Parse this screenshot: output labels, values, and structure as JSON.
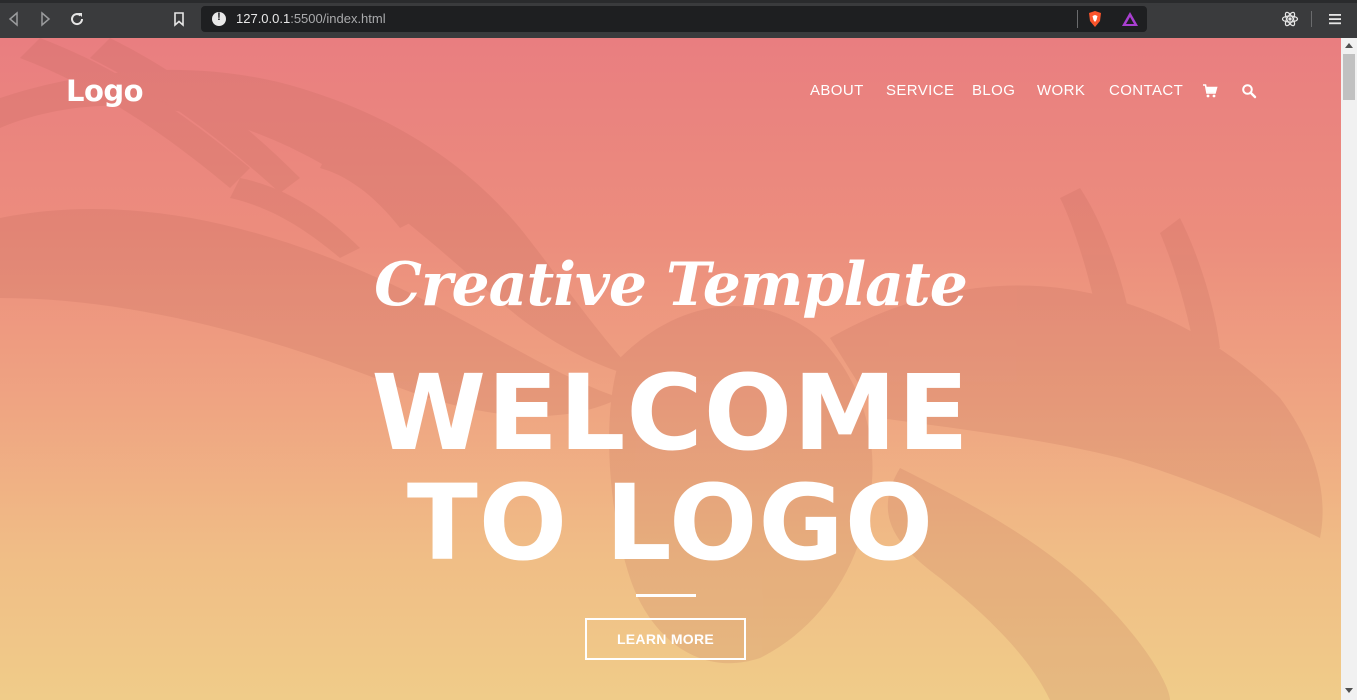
{
  "browser": {
    "url_host": "127.0.0.1",
    "url_rest": ":5500/index.html",
    "icons": [
      "back-icon",
      "forward-icon",
      "reload-icon",
      "bookmark-icon",
      "info-icon",
      "brave-shields-icon",
      "brave-rewards-icon",
      "react-devtools-icon",
      "menu-icon"
    ]
  },
  "site": {
    "logo": "Logo",
    "nav": [
      "ABOUT",
      "SERVICE",
      "BLOG",
      "WORK",
      "CONTACT"
    ],
    "nav_icons": [
      "cart-icon",
      "search-icon"
    ]
  },
  "hero": {
    "script_title": "Creative Template",
    "line1": "WELCOME",
    "line2": "TO LOGO",
    "button": "LEARN MORE"
  },
  "colors": {
    "gradient_top": "#e97e80",
    "gradient_bottom": "#f0cc89",
    "text": "#ffffff"
  }
}
